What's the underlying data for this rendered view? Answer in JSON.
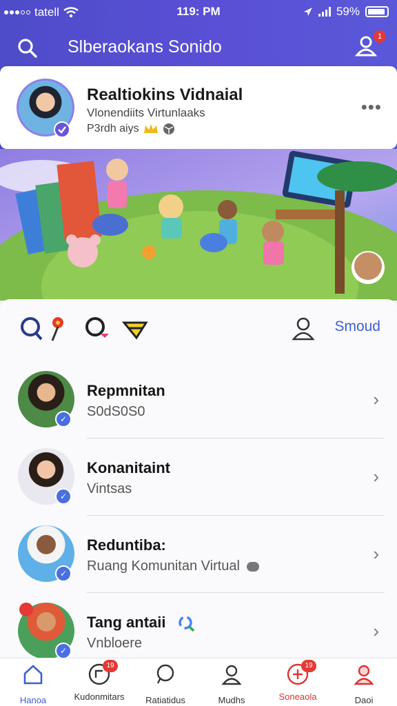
{
  "status_bar": {
    "carrier": "tatell",
    "time": "119: PM",
    "battery": "59%"
  },
  "app_bar": {
    "title": "Slberaokans Sonido",
    "notification_badge": "1",
    "icons": {
      "search": "search-icon",
      "profile": "profile-icon"
    }
  },
  "profile_card": {
    "name": "Realtiokins Vidnaial",
    "subtitle": "Vlonendiits Virtunlaaks",
    "stat": "P3rdh aiys",
    "more": "•••"
  },
  "toolbar": {
    "right_label": "Smoud",
    "icons": [
      "search-flower-icon",
      "search-heart-icon",
      "bee-icon",
      "person-icon"
    ]
  },
  "list": [
    {
      "title": "Repmnitan",
      "subtitle": "S0dS0S0"
    },
    {
      "title": "Konanitaint",
      "subtitle": "Vintsas"
    },
    {
      "title": "Reduntiba:",
      "subtitle": "Ruang Komunitan Virtual"
    },
    {
      "title": "Tang antaii",
      "subtitle": "Vnbloere"
    }
  ],
  "tabbar": [
    {
      "label": "Hanoa",
      "icon": "home-icon",
      "badge": ""
    },
    {
      "label": "Kudonmitars",
      "icon": "chat-icon",
      "badge": "19"
    },
    {
      "label": "Ratiatidus",
      "icon": "search-icon",
      "badge": ""
    },
    {
      "label": "Mudhs",
      "icon": "person-icon",
      "badge": ""
    },
    {
      "label": "Soneaola",
      "icon": "add-icon",
      "badge": "19"
    },
    {
      "label": "Daoi",
      "icon": "user-icon",
      "badge": ""
    }
  ],
  "colors": {
    "header": "#5250d2",
    "accent": "#3f5fd1",
    "badge": "#e53935"
  }
}
